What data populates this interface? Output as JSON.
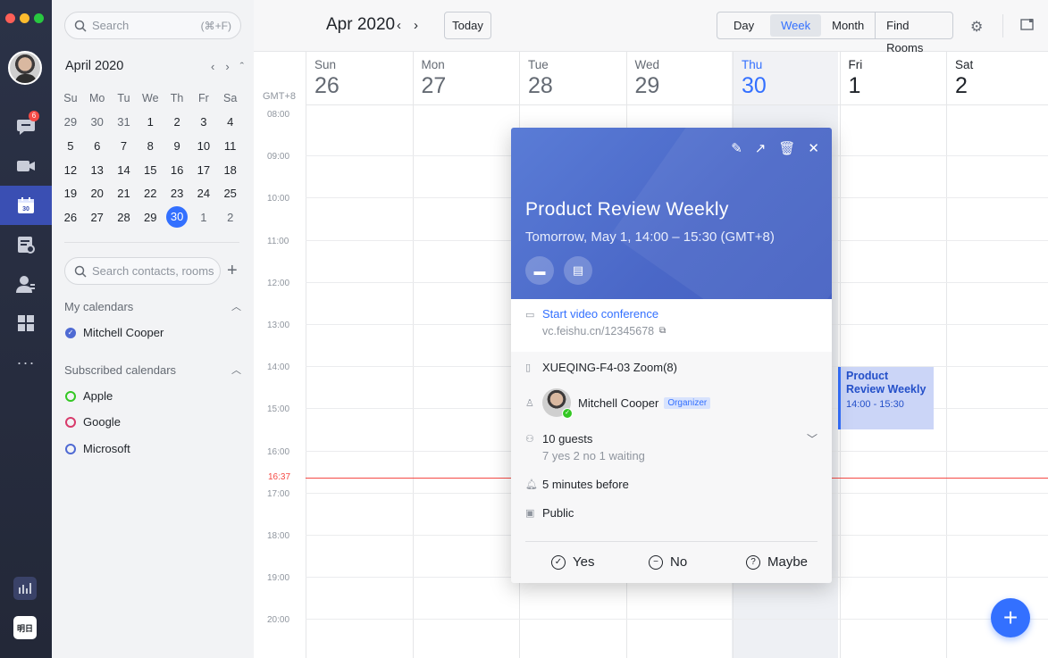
{
  "rail": {
    "chat_badge": "6",
    "bottom_app_label": "明日"
  },
  "sidebar": {
    "search_placeholder": "Search",
    "search_hint": "(⌘+F)",
    "mini_month": "April 2020",
    "dow": [
      "Su",
      "Mo",
      "Tu",
      "We",
      "Th",
      "Fr",
      "Sa"
    ],
    "weeks": [
      [
        "29",
        "30",
        "31",
        "1",
        "2",
        "3",
        "4"
      ],
      [
        "5",
        "6",
        "7",
        "8",
        "9",
        "10",
        "11"
      ],
      [
        "12",
        "13",
        "14",
        "15",
        "16",
        "17",
        "18"
      ],
      [
        "19",
        "20",
        "21",
        "22",
        "23",
        "24",
        "25"
      ],
      [
        "26",
        "27",
        "28",
        "29",
        "30",
        "1",
        "2"
      ]
    ],
    "contacts_placeholder": "Search contacts, rooms",
    "my_calendars_label": "My calendars",
    "my_calendars": [
      {
        "name": "Mitchell Cooper",
        "color": "#4f6ad3"
      }
    ],
    "subscribed_label": "Subscribed calendars",
    "subscribed": [
      {
        "name": "Apple",
        "color": "#34c724"
      },
      {
        "name": "Google",
        "color": "#d83b6b"
      },
      {
        "name": "Microsoft",
        "color": "#4f6ad3"
      }
    ]
  },
  "header": {
    "title": "Apr 2020",
    "today_label": "Today",
    "views": {
      "day": "Day",
      "week": "Week",
      "month": "Month",
      "rooms": "Find Rooms"
    },
    "selected_view": "Week"
  },
  "week": {
    "timezone": "GMT+8",
    "days": [
      {
        "name": "Sun",
        "date": "26"
      },
      {
        "name": "Mon",
        "date": "27"
      },
      {
        "name": "Tue",
        "date": "28"
      },
      {
        "name": "Wed",
        "date": "29"
      },
      {
        "name": "Thu",
        "date": "30"
      },
      {
        "name": "Fri",
        "date": "1"
      },
      {
        "name": "Sat",
        "date": "2"
      }
    ],
    "hours": [
      "08:00",
      "09:00",
      "10:00",
      "11:00",
      "12:00",
      "13:00",
      "14:00",
      "15:00",
      "16:00",
      "17:00",
      "18:00",
      "19:00",
      "20:00"
    ],
    "now_time": "16:37",
    "event": {
      "title": "Product Review Weekly",
      "time": "14:00 - 15:30"
    }
  },
  "popup": {
    "title": "Product Review Weekly",
    "subtitle": "Tomorrow, May 1, 14:00 – 15:30 (GMT+8)",
    "vc_link": "Start video conference",
    "vc_url": "vc.feishu.cn/12345678",
    "room": "XUEQING-F4-03 Zoom(8)",
    "organizer": "Mitchell Cooper",
    "organizer_badge": "Organizer",
    "guests": "10 guests",
    "guests_detail": "7 yes 2 no 1 waiting",
    "reminder": "5 minutes before",
    "visibility": "Public",
    "yes": "Yes",
    "no": "No",
    "maybe": "Maybe"
  },
  "colors": {
    "accent": "#3370ff",
    "now": "#f54a45",
    "rail": "#2b3247"
  }
}
